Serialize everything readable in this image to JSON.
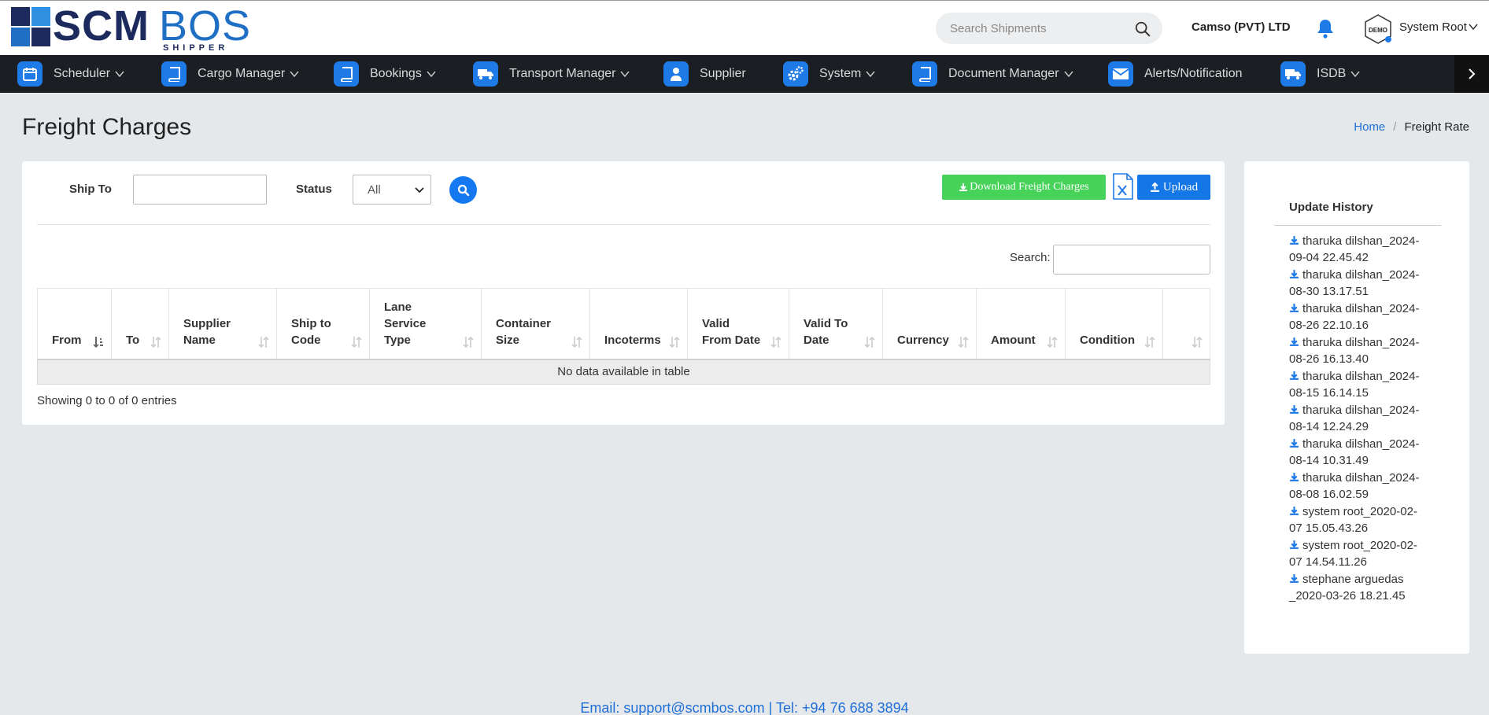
{
  "brand": {
    "logo_main": "SCM",
    "logo_accent": "BOS",
    "logo_sub": "SHIPPER",
    "colors": {
      "nav_bg": "#1b1f23",
      "accent": "#1e7ae6",
      "download_green": "#47d25a",
      "link_blue": "#1f6fd8"
    }
  },
  "header": {
    "search_placeholder": "Search Shipments",
    "company": "Camso (PVT) LTD",
    "avatar_badge": "DEMO",
    "user_name": "System Root"
  },
  "nav": {
    "items": [
      {
        "label": "Scheduler",
        "icon": "calendar-icon",
        "has_menu": true
      },
      {
        "label": "Cargo Manager",
        "icon": "book-icon",
        "has_menu": true
      },
      {
        "label": "Bookings",
        "icon": "book-icon",
        "has_menu": true
      },
      {
        "label": "Transport Manager",
        "icon": "truck-icon",
        "has_menu": true
      },
      {
        "label": "Supplier",
        "icon": "user-icon",
        "has_menu": false
      },
      {
        "label": "System",
        "icon": "gears-icon",
        "has_menu": true
      },
      {
        "label": "Document Manager",
        "icon": "book-icon",
        "has_menu": true
      },
      {
        "label": "Alerts/Notification",
        "icon": "envelope-icon",
        "has_menu": false
      },
      {
        "label": "ISDB",
        "icon": "truck-icon",
        "has_menu": true
      }
    ]
  },
  "page": {
    "title": "Freight Charges",
    "breadcrumb_home": "Home",
    "breadcrumb_sep": "/",
    "breadcrumb_current": "Freight Rate"
  },
  "filters": {
    "ship_to_label": "Ship To",
    "ship_to_value": "",
    "status_label": "Status",
    "status_selected": "All",
    "download_label": "Download Freight Charges",
    "upload_label": "Upload"
  },
  "table": {
    "search_label": "Search:",
    "search_value": "",
    "columns": [
      [
        "From"
      ],
      [
        "To"
      ],
      [
        "Supplier",
        "Name"
      ],
      [
        "Ship to",
        "Code"
      ],
      [
        "Lane",
        "Service",
        "Type"
      ],
      [
        "Container",
        "Size"
      ],
      [
        "Incoterms"
      ],
      [
        "Valid",
        "From Date"
      ],
      [
        "Valid To",
        "Date"
      ],
      [
        "Currency"
      ],
      [
        "Amount"
      ],
      [
        "Condition"
      ],
      [
        ""
      ]
    ],
    "empty_text": "No data available in table",
    "showing_text": "Showing 0 to 0 of 0 entries"
  },
  "history": {
    "title": "Update History",
    "entries": [
      [
        "tharuka dilshan_2024-",
        "09-04 22.45.42"
      ],
      [
        "tharuka dilshan_2024-",
        "08-30 13.17.51"
      ],
      [
        "tharuka dilshan_2024-",
        "08-26 22.10.16"
      ],
      [
        "tharuka dilshan_2024-",
        "08-26 16.13.40"
      ],
      [
        "tharuka dilshan_2024-",
        "08-15 16.14.15"
      ],
      [
        "tharuka dilshan_2024-",
        "08-14 12.24.29"
      ],
      [
        "tharuka dilshan_2024-",
        "08-14 10.31.49"
      ],
      [
        "tharuka dilshan_2024-",
        "08-08 16.02.59"
      ],
      [
        "system root_2020-02-",
        "07 15.05.43.26"
      ],
      [
        "system root_2020-02-",
        "07 14.54.11.26"
      ],
      [
        "stephane arguedas",
        "_2020-03-26 18.21.45"
      ]
    ]
  },
  "footer": {
    "text": "Email: support@scmbos.com | Tel: +94 76 688 3894"
  }
}
